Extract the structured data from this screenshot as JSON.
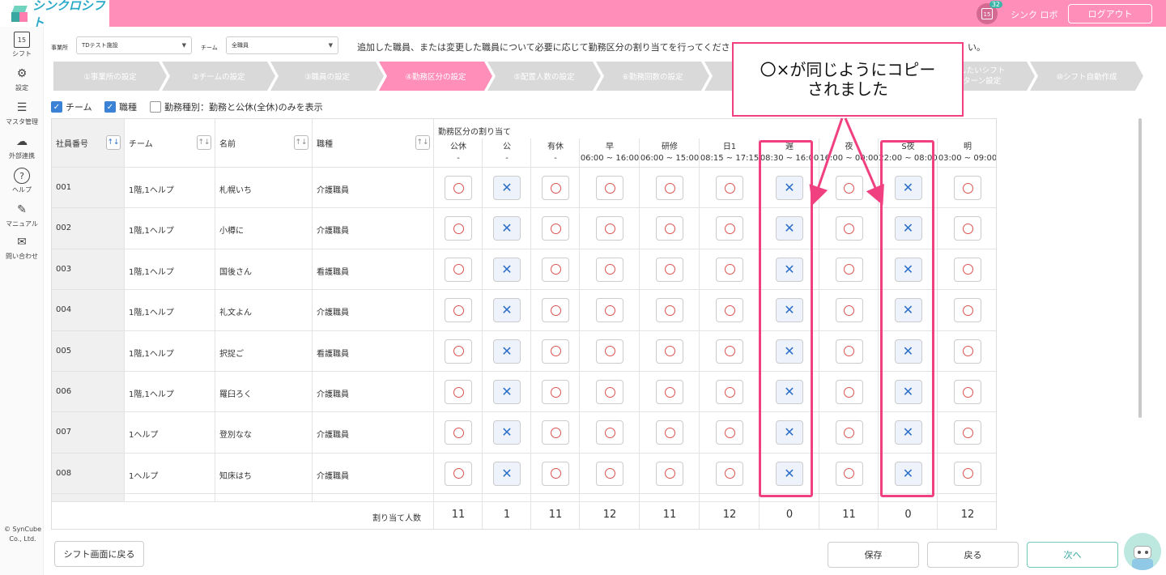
{
  "header": {
    "logo_text": "シンクロシフト",
    "calendar_day": "15",
    "notification_count": "32",
    "user_name": "シンク ロボ",
    "logout_label": "ログアウト"
  },
  "sidebar": {
    "items": [
      {
        "label": "シフト",
        "icon": "calendar-icon",
        "glyph": "15"
      },
      {
        "label": "設定",
        "icon": "gear-icon",
        "glyph": "⚙"
      },
      {
        "label": "マスタ管理",
        "icon": "database-icon",
        "glyph": "☰"
      },
      {
        "label": "外部連携",
        "icon": "cloud-link-icon",
        "glyph": "☁"
      },
      {
        "label": "ヘルプ",
        "icon": "help-icon",
        "glyph": "?"
      },
      {
        "label": "マニュアル",
        "icon": "pencil-icon",
        "glyph": "✎"
      },
      {
        "label": "問い合わせ",
        "icon": "mail-icon",
        "glyph": "✉"
      }
    ],
    "copyright": "© SynCube Co., Ltd."
  },
  "filters": {
    "office_label": "事業所",
    "office_value": "TDテスト施設",
    "team_label": "チーム",
    "team_value": "全職員",
    "instruction": "追加した職員、または変更した職員について必要に応じて勤務区分の割り当てを行ってくださ",
    "instruction_tail": "い。"
  },
  "steps": [
    {
      "label": "①事業所の設定"
    },
    {
      "label": "②チームの設定"
    },
    {
      "label": "③職員の設定"
    },
    {
      "label": "④勤務区分の設定"
    },
    {
      "label": "⑤配置人数の設定"
    },
    {
      "label": "⑥勤務回数の設定"
    },
    {
      "label": ""
    },
    {
      "label": ""
    },
    {
      "label": "望したいシフト",
      "label2": "パターン設定"
    },
    {
      "label": "⑩シフト自動作成"
    }
  ],
  "checkboxes": [
    {
      "label": "チーム",
      "checked": true
    },
    {
      "label": "職種",
      "checked": true
    },
    {
      "label": "勤務種別：勤務と公休(全休)のみを表示",
      "checked": false
    }
  ],
  "table": {
    "headers": {
      "employee_id": "社員番号",
      "team": "チーム",
      "name": "名前",
      "job": "職種",
      "assignment_group": "勤務区分の割り当て",
      "sort_glyph": "↑↓"
    },
    "shift_columns": [
      {
        "name": "公休",
        "time": "-"
      },
      {
        "name": "公",
        "time": "-"
      },
      {
        "name": "有休",
        "time": "-"
      },
      {
        "name": "早",
        "time": "06:00 ~ 16:00"
      },
      {
        "name": "研修",
        "time": "06:00 ~ 15:00"
      },
      {
        "name": "日1",
        "time": "08:15 ~ 17:15"
      },
      {
        "name": "遅",
        "time": "08:30 ~ 16:00"
      },
      {
        "name": "夜",
        "time": "16:00 ~ 00:00"
      },
      {
        "name": "S夜",
        "time": "22:00 ~ 08:00"
      },
      {
        "name": "明",
        "time": "03:00 ~ 09:00"
      }
    ],
    "rows": [
      {
        "id": "001",
        "team": "1階,1ヘルプ",
        "name": "札幌いち",
        "job": "介護職員",
        "marks": [
          "o",
          "x",
          "o",
          "o",
          "o",
          "o",
          "x",
          "o",
          "x",
          "o"
        ]
      },
      {
        "id": "002",
        "team": "1階,1ヘルプ",
        "name": "小樽に",
        "job": "介護職員",
        "marks": [
          "o",
          "x",
          "o",
          "o",
          "o",
          "o",
          "x",
          "o",
          "x",
          "o"
        ]
      },
      {
        "id": "003",
        "team": "1階,1ヘルプ",
        "name": "国後さん",
        "job": "看護職員",
        "marks": [
          "o",
          "x",
          "o",
          "o",
          "o",
          "o",
          "x",
          "o",
          "x",
          "o"
        ]
      },
      {
        "id": "004",
        "team": "1階,1ヘルプ",
        "name": "礼文よん",
        "job": "介護職員",
        "marks": [
          "o",
          "x",
          "o",
          "o",
          "o",
          "o",
          "x",
          "o",
          "x",
          "o"
        ]
      },
      {
        "id": "005",
        "team": "1階,1ヘルプ",
        "name": "択捉ご",
        "job": "看護職員",
        "marks": [
          "o",
          "x",
          "o",
          "o",
          "o",
          "o",
          "x",
          "o",
          "x",
          "o"
        ]
      },
      {
        "id": "006",
        "team": "1階,1ヘルプ",
        "name": "羅臼ろく",
        "job": "介護職員",
        "marks": [
          "o",
          "x",
          "o",
          "o",
          "o",
          "o",
          "x",
          "o",
          "x",
          "o"
        ]
      },
      {
        "id": "007",
        "team": "1ヘルプ",
        "name": "登別なな",
        "job": "介護職員",
        "marks": [
          "o",
          "x",
          "o",
          "o",
          "o",
          "o",
          "x",
          "o",
          "x",
          "o"
        ]
      },
      {
        "id": "008",
        "team": "1ヘルプ",
        "name": "知床はち",
        "job": "介護職員",
        "marks": [
          "o",
          "x",
          "o",
          "o",
          "o",
          "o",
          "x",
          "o",
          "x",
          "o"
        ]
      }
    ],
    "total_label": "割り当て人数",
    "totals": [
      "11",
      "1",
      "11",
      "12",
      "11",
      "12",
      "0",
      "11",
      "0",
      "12"
    ]
  },
  "buttons": {
    "back_to_shift": "シフト画面に戻る",
    "save": "保存",
    "back": "戻る",
    "next": "次へ"
  },
  "annotation": {
    "line1": "〇×が同じようにコピー",
    "line2": "されました",
    "color": "#f0407f"
  },
  "colors": {
    "brand_pink": "#ff8fb8",
    "checkbox_blue": "#3b82d6",
    "x_mark_blue": "#2c6fc9",
    "o_mark_red": "#d9534f",
    "next_teal": "#3aa7a0"
  }
}
